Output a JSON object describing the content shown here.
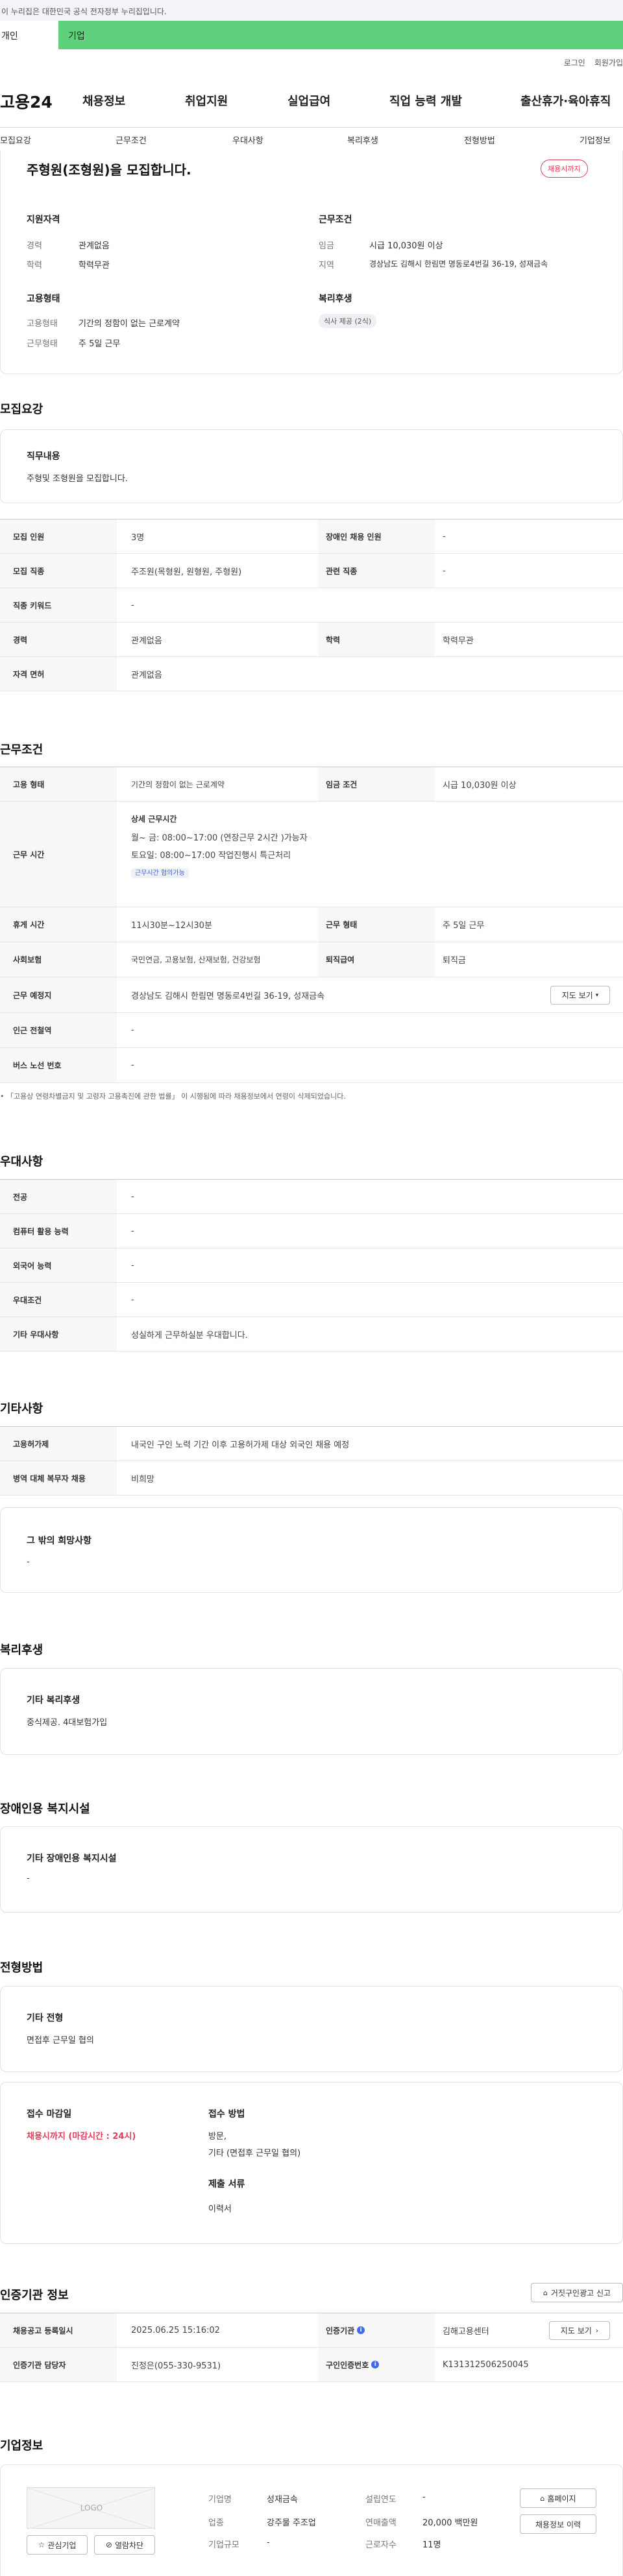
{
  "gov_banner": "이 누리집은 대한민국 공식 전자정부 누리집입니다.",
  "top_tabs": [
    "개인",
    "기업"
  ],
  "util_links": [
    "로그인",
    "회원가입"
  ],
  "logo": "고용24",
  "gnb": [
    "채용정보",
    "취업지원",
    "실업급여",
    "직업 능력 개발",
    "출산휴가·육아휴직"
  ],
  "subnav": [
    "모집요강",
    "근무조건",
    "우대사항",
    "복리후생",
    "전형방법",
    "기업정보"
  ],
  "summary": {
    "title": "주형원(조형원)을 모집합니다.",
    "status_badge": "채용시까지",
    "qual_title": "지원자격",
    "qual": [
      [
        "경력",
        "관계없음"
      ],
      [
        "학력",
        "학력무관"
      ]
    ],
    "cond_title": "근무조건",
    "cond": [
      [
        "임금",
        "시급 10,030원 이상"
      ],
      [
        "지역",
        "경상남도 김해시 한림면 명동로4번길 36-19, 성재금속"
      ]
    ],
    "emp_title": "고용형태",
    "emp": [
      [
        "고용형태",
        "기간의 정함이 없는 근로계약"
      ],
      [
        "근무형태",
        "주 5일 근무"
      ]
    ],
    "welfare_title": "복리후생",
    "welfare_chip": "식사 제공 (2식)"
  },
  "recruit": {
    "heading": "모집요강",
    "job_title": "직무내용",
    "job_text": "주형및 조형원을 모집합니다.",
    "rows": [
      [
        "모집 인원",
        "3명",
        "장애인 채용 인원",
        "-"
      ],
      [
        "모집 직종",
        "주조원(목형원, 원형원, 주형원)",
        "관련 직종",
        "-"
      ],
      [
        "직종 키워드",
        "-"
      ],
      [
        "경력",
        "관계없음",
        "학력",
        "학력무관"
      ],
      [
        "자격 면허",
        "관계없음"
      ]
    ]
  },
  "conditions": {
    "heading": "근무조건",
    "row1": [
      "고용 형태",
      "기간의 정함이 없는 근로계약",
      "임금 조건",
      "시급 10,030원 이상"
    ],
    "time_label": "근무 시간",
    "time_sub": "상세 근무시간",
    "time_lines": [
      "월~ 금: 08:00~17:00 (연장근무 2시간 )가능자",
      "토요일: 08:00~17:00 작업진행시 특근처리"
    ],
    "time_chip": "근무시간 협의가능",
    "row3": [
      "휴게 시간",
      "11시30분~12시30분",
      "근무 형태",
      "주 5일 근무"
    ],
    "row4": [
      "사회보험",
      "국민연금, 고용보험, 산재보험, 건강보험",
      "퇴직급여",
      "퇴직금"
    ],
    "row5": [
      "근무 예정지",
      "경상남도 김해시 한림면 명동로4번길 36-19, 성재금속"
    ],
    "map_btn": "지도 보기",
    "row6": [
      "인근 전철역",
      "-"
    ],
    "row7": [
      "버스 노선 번호",
      "-"
    ],
    "note": "「고용상 연령차별금지 및 고령자 고용촉진에 관한 법률」 이 시행됨에 따라 채용정보에서 연령이 삭제되었습니다."
  },
  "preference": {
    "heading": "우대사항",
    "rows": [
      [
        "전공",
        "-"
      ],
      [
        "컴퓨터 활용 능력",
        "-"
      ],
      [
        "외국어 능력",
        "-"
      ],
      [
        "우대조건",
        "-"
      ],
      [
        "기타 우대사항",
        "성실하게 근무하실분 우대합니다."
      ]
    ]
  },
  "other": {
    "heading": "기타사항",
    "rows": [
      [
        "고용허가제",
        "내국인 구인 노력 기간 이후 고용허가제 대상 외국인 채용 예정"
      ],
      [
        "병역 대체 복무자 채용",
        "비희망"
      ]
    ],
    "wish_title": "그 밖의 희망사항",
    "wish_text": "-"
  },
  "benefits": {
    "heading": "복리후생",
    "title": "기타 복리후생",
    "text": "중식제공. 4대보험가입"
  },
  "disabled": {
    "heading": "장애인용 복지시설",
    "title": "기타 장애인용 복지시설",
    "text": "-"
  },
  "selection": {
    "heading": "전형방법",
    "title": "기타 전형",
    "text": "면접후 근무일 협의",
    "deadline_title": "접수 마감일",
    "deadline": "채용시까지 (마감시간 : 24시)",
    "method_title": "접수 방법",
    "method_lines": [
      "방문,",
      "기타 (면접후 근무일 협의)"
    ],
    "docs_title": "제출 서류",
    "docs": "이력서"
  },
  "cert": {
    "heading": "인증기관 정보",
    "report_btn": "거짓구인광고 신고",
    "row1": [
      "채용공고 등록일시",
      "2025.06.25 15:16:02",
      "인증기관",
      "김해고용센터"
    ],
    "row2": [
      "인증기관 담당자",
      "진정은(055-330-9531)",
      "구인인증번호",
      "K131312506250045"
    ],
    "map_btn": "지도 보기"
  },
  "company": {
    "heading": "기업정보",
    "logo_text": "LOGO",
    "interest_btn": "관심기업",
    "block_btn": "열람차단",
    "fields": [
      [
        "기업명",
        "성재금속"
      ],
      [
        "업종",
        "강주물 주조업"
      ],
      [
        "기업규모",
        "-"
      ],
      [
        "설립연도",
        "-"
      ],
      [
        "연매출액",
        "20,000 백만원"
      ],
      [
        "근로자수",
        "11명"
      ]
    ],
    "home_btn": "홈페이지",
    "history_btn": "채용정보 이력"
  },
  "colors": {
    "accent_green": "#5fd17d",
    "accent_red": "#e03c5a",
    "accent_blue": "#3e6cf0"
  }
}
